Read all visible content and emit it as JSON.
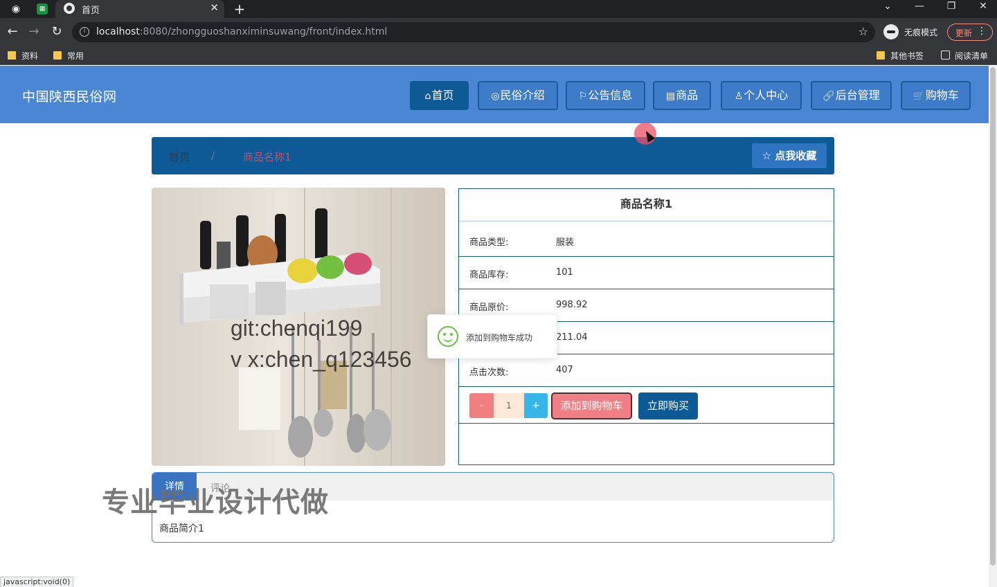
{
  "browser": {
    "tab_title": "首页",
    "tab_close": "✕",
    "new_tab": "+",
    "url_host": "localhost",
    "url_rest": ":8080/zhongguoshanximinsuwang/front/index.html",
    "incognito_label": "无痕模式",
    "update_label": "更新",
    "bookmarks": [
      "资料",
      "常用"
    ],
    "bookmarks_right": [
      "其他书签",
      "阅读清单"
    ],
    "status_tip": "javascript:void(0)"
  },
  "site": {
    "brand": "中国陕西民俗网",
    "nav": [
      {
        "icon": "⌂",
        "label": "首页"
      },
      {
        "icon": "◎",
        "label": "民俗介绍"
      },
      {
        "icon": "⚐",
        "label": "公告信息"
      },
      {
        "icon": "▤",
        "label": "商品"
      },
      {
        "icon": "♙",
        "label": "个人中心"
      },
      {
        "icon": "🔗",
        "label": "后台管理"
      },
      {
        "icon": "🛒",
        "label": "购物车"
      }
    ]
  },
  "breadcrumb": {
    "home": "首页",
    "separator": "/",
    "current": "商品名称1",
    "favorite_button": "☆ 点我收藏"
  },
  "product": {
    "name": "商品名称1",
    "rows": [
      {
        "key": "商品类型:",
        "value": "服装"
      },
      {
        "key": "商品库存:",
        "value": "101"
      },
      {
        "key": "商品原价:",
        "value": "998.92"
      },
      {
        "key": "",
        "value": "211.04"
      },
      {
        "key": "点击次数:",
        "value": "407"
      }
    ],
    "quantity": "1",
    "minus": "-",
    "plus": "+",
    "add_to_cart": "添加到购物车",
    "buy_now": "立即购买"
  },
  "toast": {
    "message": "添加到购物车成功"
  },
  "detail_tabs": {
    "detail": "详情",
    "comment": "评论",
    "description": "商品简介1"
  },
  "watermarks": {
    "line1": "git:chenqi199",
    "line2": "v x:chen_q123456",
    "banner": "专业毕业设计代做"
  }
}
